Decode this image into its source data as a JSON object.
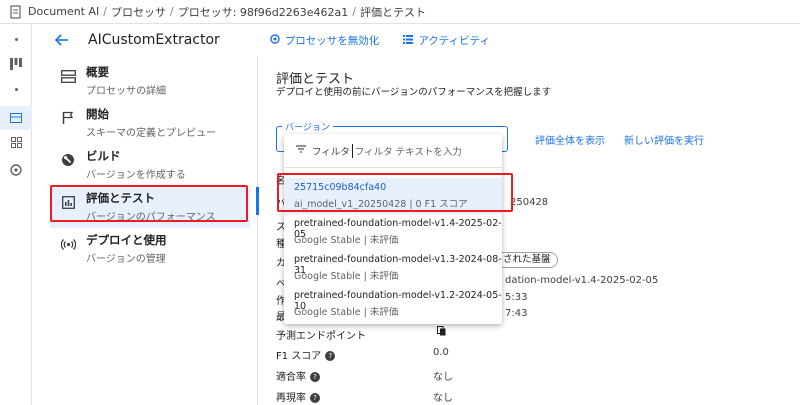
{
  "breadcrumb": {
    "items": [
      "Document AI",
      "プロセッサ",
      "プロセッサ: 98f96d2263e462a1",
      "評価とテスト"
    ]
  },
  "header": {
    "title": "AICustomExtractor",
    "disable_label": "プロセッサを無効化",
    "activity_label": "アクティビティ"
  },
  "nav": {
    "items": [
      {
        "label": "概要",
        "sub": "プロセッサの詳細",
        "icon": "overview-icon"
      },
      {
        "label": "開始",
        "sub": "スキーマの定義とプレビュー",
        "icon": "flag-icon"
      },
      {
        "label": "ビルド",
        "sub": "バージョンを作成する",
        "icon": "build-icon"
      },
      {
        "label": "評価とテスト",
        "sub": "バージョンのパフォーマンス",
        "icon": "chart-icon"
      },
      {
        "label": "デプロイと使用",
        "sub": "バージョンの管理",
        "icon": "deploy-icon"
      }
    ]
  },
  "main": {
    "title": "評価とテスト",
    "subtitle": "デプロイと使用の前にバージョンのパフォーマンスを把握します",
    "version_label": "バージョン",
    "eval_all_link": "評価全体を表示",
    "new_eval_link": "新しい評価を実行",
    "partial_values": {
      "v1": "250428",
      "v2": "された基盤",
      "v3": "dation-model-v1.4-2025-02-05",
      "v4": "5:33",
      "v5": "7:43"
    },
    "details": [
      {
        "label": "予測エンドポイント",
        "value": ""
      },
      {
        "label": "F1 スコア",
        "value": "0.0"
      },
      {
        "label": "適合率",
        "value": "なし"
      },
      {
        "label": "再現率",
        "value": "なし"
      }
    ],
    "left_labels": [
      "名",
      "バ",
      "ス",
      "種",
      "カ",
      "ベ",
      "作",
      "最"
    ]
  },
  "dropdown": {
    "filter_label": "フィルタ",
    "filter_placeholder": "フィルタ テキストを入力",
    "options": [
      {
        "title": "25715c09b84cfa40",
        "sub": "ai_model_v1_20250428 | 0 F1 スコア"
      },
      {
        "title": "pretrained-foundation-model-v1.4-2025-02-05",
        "sub": "Google Stable | 未評価"
      },
      {
        "title": "pretrained-foundation-model-v1.3-2024-08-31",
        "sub": "Google Stable | 未評価"
      },
      {
        "title": "pretrained-foundation-model-v1.2-2024-05-10",
        "sub": "Google Stable | 未評価"
      }
    ]
  },
  "colors": {
    "accent": "#1a73e8",
    "highlight": "#ea1c24",
    "selected_bg": "#e8f0fe"
  }
}
